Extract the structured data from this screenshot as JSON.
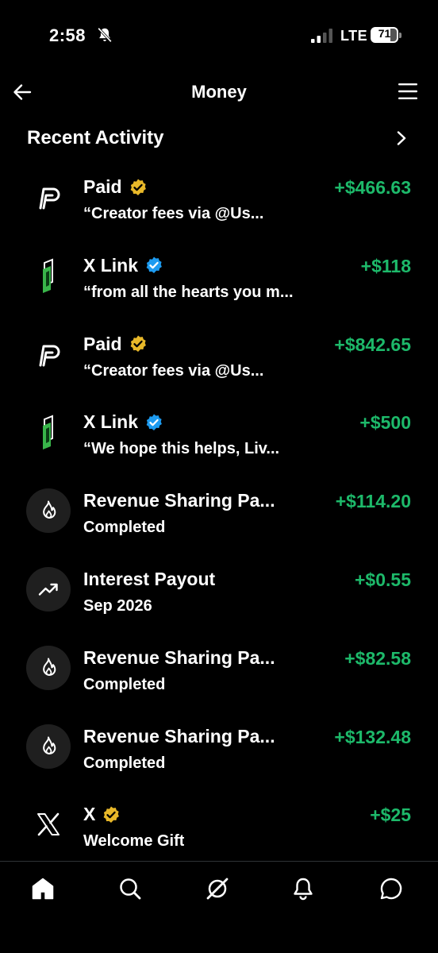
{
  "status_bar": {
    "time": "2:58",
    "network": "LTE",
    "battery": "71"
  },
  "header": {
    "title": "Money"
  },
  "section": {
    "title": "Recent Activity"
  },
  "activities": [
    {
      "title": "Paid",
      "subtitle": "“Creator fees via @Us...",
      "amount": "+$466.63",
      "icon": "paid-logo-icon",
      "badge": "gold-verified-icon"
    },
    {
      "title": "X Link",
      "subtitle": "“from all the hearts you m...",
      "amount": "+$118",
      "icon": "xlink-logo-icon",
      "badge": "blue-verified-icon"
    },
    {
      "title": "Paid",
      "subtitle": "“Creator fees via @Us...",
      "amount": "+$842.65",
      "icon": "paid-logo-icon",
      "badge": "gold-verified-icon"
    },
    {
      "title": "X Link",
      "subtitle": "“We hope this helps, Liv...",
      "amount": "+$500",
      "icon": "xlink-logo-icon",
      "badge": "blue-verified-icon"
    },
    {
      "title": "Revenue Sharing Pa...",
      "subtitle": "Completed",
      "amount": "+$114.20",
      "icon": "flame-icon",
      "badge": ""
    },
    {
      "title": "Interest Payout",
      "subtitle": "Sep 2026",
      "amount": "+$0.55",
      "icon": "trending-up-icon",
      "badge": ""
    },
    {
      "title": "Revenue Sharing Pa...",
      "subtitle": "Completed",
      "amount": "+$82.58",
      "icon": "flame-icon",
      "badge": ""
    },
    {
      "title": "Revenue Sharing Pa...",
      "subtitle": "Completed",
      "amount": "+$132.48",
      "icon": "flame-icon",
      "badge": ""
    },
    {
      "title": "X",
      "subtitle": "Welcome Gift",
      "amount": "+$25",
      "icon": "x-logo-icon",
      "badge": "gold-verified-icon"
    }
  ],
  "bottom_nav": [
    {
      "name": "home",
      "icon": "home-icon",
      "active": true
    },
    {
      "name": "search",
      "icon": "search-icon",
      "active": false
    },
    {
      "name": "grok",
      "icon": "grok-icon",
      "active": false
    },
    {
      "name": "notifications",
      "icon": "bell-icon",
      "active": false
    },
    {
      "name": "messages",
      "icon": "chat-icon",
      "active": false
    }
  ],
  "colors": {
    "background": "#000000",
    "amount_green": "#1db96a",
    "verified_gold": "#e8b829",
    "verified_blue": "#1d9bf0",
    "avatar_bg": "#1f1f1f",
    "xlink_green": "#39b54a"
  }
}
